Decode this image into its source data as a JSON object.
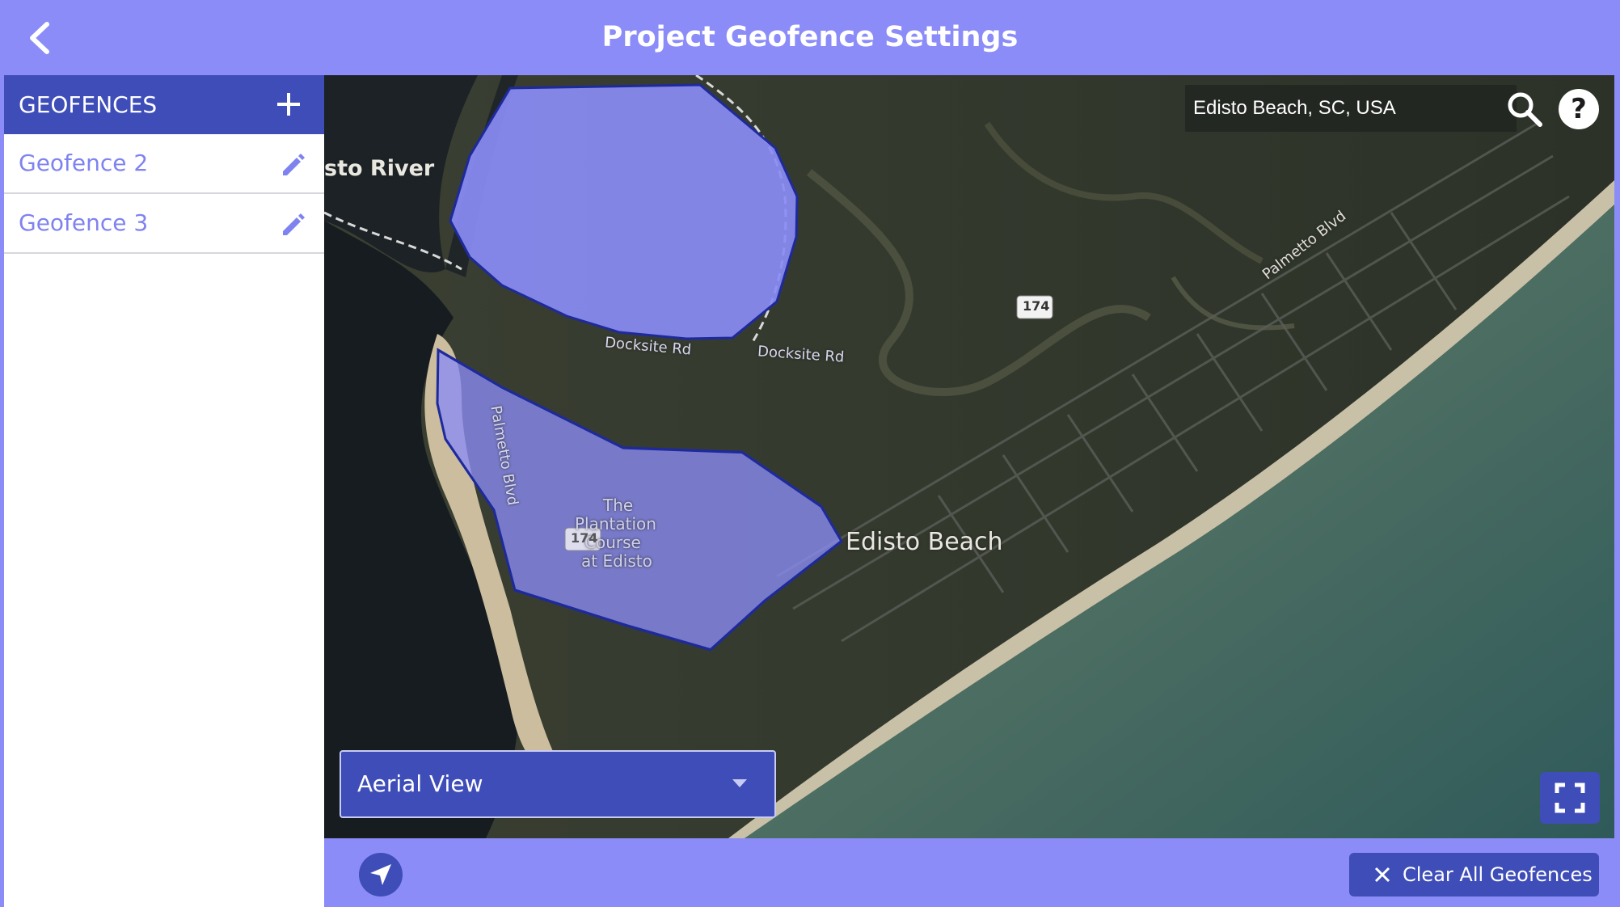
{
  "header": {
    "title": "Project Geofence Settings"
  },
  "sidebar": {
    "title": "GEOFENCES",
    "items": [
      {
        "label": "Geofence 2"
      },
      {
        "label": "Geofence 3"
      }
    ]
  },
  "map": {
    "search": {
      "value": "Edisto Beach, SC, USA"
    },
    "labels": {
      "river": "sto River",
      "beach": "Edisto Beach",
      "road_docksite_1": "Docksite Rd",
      "road_docksite_2": "Docksite Rd",
      "road_palmetto_1": "Palmetto Blvd",
      "road_palmetto_2": "Palmetto Blvd",
      "course_1": "The",
      "course_2": "Plantation",
      "course_3": "Course",
      "course_4": "at Edisto",
      "route_174_a": "174",
      "route_174_b": "174"
    },
    "view_select": {
      "value": "Aerial View"
    },
    "help_symbol": "?"
  },
  "footer": {
    "clear_label": "Clear All Geofences"
  },
  "icons": {
    "back": "chevron-left-icon",
    "add": "plus-icon",
    "edit": "pencil-icon",
    "search": "search-icon",
    "help": "help-icon",
    "fullscreen": "fullscreen-icon",
    "locate": "navigation-arrow-icon",
    "clear": "close-icon"
  },
  "colors": {
    "header_bg": "#8b8cf8",
    "accent": "#3e4db8",
    "item_text": "#7f83f0",
    "geofence_fill": "#8a8cf5",
    "geofence_stroke": "#1e2a9c"
  }
}
